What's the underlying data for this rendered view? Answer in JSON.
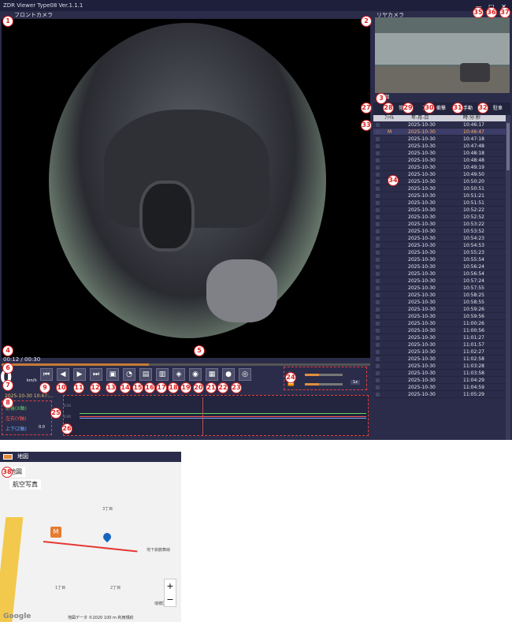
{
  "app": {
    "title": "ZDR Viewer Type08 Ver.1.1.1",
    "window_buttons": "— □ ✕"
  },
  "front": {
    "label": "フロントカメラ"
  },
  "rear": {
    "label": "リヤカメラ"
  },
  "list": {
    "header": "地図",
    "filters": [
      "常",
      "常",
      "ア",
      "衝撃",
      "手動",
      "駐車"
    ],
    "columns": [
      "ﾌｧｲﾙ",
      "年-月-日",
      "時:分:秒"
    ],
    "rows": [
      {
        "m": "",
        "date": "2025-10-30",
        "time": "10:46:17"
      },
      {
        "m": "M",
        "date": "2025-10-30",
        "time": "10:46:47"
      },
      {
        "m": "",
        "date": "2025-10-30",
        "time": "10:47:18"
      },
      {
        "m": "",
        "date": "2025-10-30",
        "time": "10:47:48"
      },
      {
        "m": "",
        "date": "2025-10-30",
        "time": "10:48:18"
      },
      {
        "m": "",
        "date": "2025-10-30",
        "time": "10:48:48"
      },
      {
        "m": "",
        "date": "2025-10-30",
        "time": "10:49:19"
      },
      {
        "m": "",
        "date": "2025-10-30",
        "time": "10:49:50"
      },
      {
        "m": "",
        "date": "2025-10-30",
        "time": "10:50:20"
      },
      {
        "m": "",
        "date": "2025-10-30",
        "time": "10:50:51"
      },
      {
        "m": "",
        "date": "2025-10-30",
        "time": "10:51:21"
      },
      {
        "m": "",
        "date": "2025-10-30",
        "time": "10:51:51"
      },
      {
        "m": "",
        "date": "2025-10-30",
        "time": "10:52:22"
      },
      {
        "m": "",
        "date": "2025-10-30",
        "time": "10:52:52"
      },
      {
        "m": "",
        "date": "2025-10-30",
        "time": "10:53:22"
      },
      {
        "m": "",
        "date": "2025-10-30",
        "time": "10:53:52"
      },
      {
        "m": "",
        "date": "2025-10-30",
        "time": "10:54:23"
      },
      {
        "m": "",
        "date": "2025-10-30",
        "time": "10:54:53"
      },
      {
        "m": "",
        "date": "2025-10-30",
        "time": "10:55:23"
      },
      {
        "m": "",
        "date": "2025-10-30",
        "time": "10:55:54"
      },
      {
        "m": "",
        "date": "2025-10-30",
        "time": "10:56:24"
      },
      {
        "m": "",
        "date": "2025-10-30",
        "time": "10:56:54"
      },
      {
        "m": "",
        "date": "2025-10-30",
        "time": "10:57:24"
      },
      {
        "m": "",
        "date": "2025-10-30",
        "time": "10:57:55"
      },
      {
        "m": "",
        "date": "2025-10-30",
        "time": "10:58:25"
      },
      {
        "m": "",
        "date": "2025-10-30",
        "time": "10:58:55"
      },
      {
        "m": "",
        "date": "2025-10-30",
        "time": "10:59:26"
      },
      {
        "m": "",
        "date": "2025-10-30",
        "time": "10:59:56"
      },
      {
        "m": "",
        "date": "2025-10-30",
        "time": "11:00:26"
      },
      {
        "m": "",
        "date": "2025-10-30",
        "time": "11:00:56"
      },
      {
        "m": "",
        "date": "2025-10-30",
        "time": "11:01:27"
      },
      {
        "m": "",
        "date": "2025-10-30",
        "time": "11:01:57"
      },
      {
        "m": "",
        "date": "2025-10-30",
        "time": "11:02:27"
      },
      {
        "m": "",
        "date": "2025-10-30",
        "time": "11:02:58"
      },
      {
        "m": "",
        "date": "2025-10-30",
        "time": "11:03:28"
      },
      {
        "m": "",
        "date": "2025-10-30",
        "time": "11:03:58"
      },
      {
        "m": "",
        "date": "2025-10-30",
        "time": "11:04:29"
      },
      {
        "m": "",
        "date": "2025-10-30",
        "time": "11:04:59"
      },
      {
        "m": "",
        "date": "2025-10-30",
        "time": "11:05:29"
      }
    ]
  },
  "player": {
    "current": "00:12",
    "total": "00:30",
    "progress_pct": 40,
    "speed": "0",
    "speed_unit": "km/h",
    "datetime": "2025-10-30 10:47:...",
    "playback_rate": "1x"
  },
  "gsensor": {
    "x": "前後(X軸)",
    "y": "左右(Y軸)",
    "z": "上下(Z軸)",
    "x_val": "",
    "y_val": "",
    "z_val": "0.0"
  },
  "graph": {
    "ticks": [
      "0.50",
      "0.00",
      "-0.50"
    ]
  },
  "map": {
    "header": "地図",
    "options": [
      "地図",
      "航空写真"
    ],
    "marker": "M",
    "footer": "地図データ ©2020   100 m          利用規約",
    "google": "Google",
    "road": "地下鉄鶴舞線",
    "labels": [
      "3丁目",
      "1丁目",
      "2丁目",
      "瑞穂区"
    ]
  },
  "annotations": [
    "1",
    "2",
    "3",
    "4",
    "5",
    "6",
    "7",
    "8",
    "9",
    "10",
    "11",
    "12",
    "13",
    "14",
    "15",
    "16",
    "17",
    "18",
    "19",
    "20",
    "21",
    "22",
    "23",
    "24",
    "25",
    "26",
    "27",
    "28",
    "29",
    "30",
    "31",
    "32",
    "33",
    "34",
    "35",
    "36",
    "37",
    "38"
  ],
  "colors": {
    "window_bg": "#2b2c49",
    "accent": "#e09040",
    "selected_text": "#ffb060",
    "annotation": "#dd2222"
  }
}
